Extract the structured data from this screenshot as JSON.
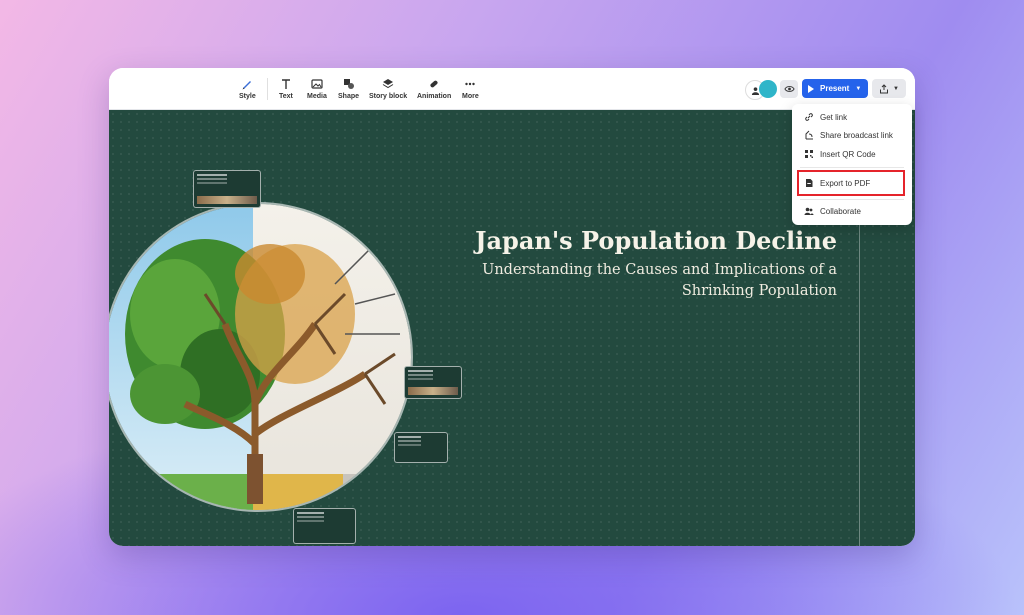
{
  "toolbar": {
    "tools": [
      {
        "label": "Style",
        "icon": "pen-icon"
      },
      {
        "label": "Text",
        "icon": "text-icon"
      },
      {
        "label": "Media",
        "icon": "image-icon"
      },
      {
        "label": "Shape",
        "icon": "shape-icon"
      },
      {
        "label": "Story block",
        "icon": "layers-icon"
      },
      {
        "label": "Animation",
        "icon": "animation-icon"
      },
      {
        "label": "More",
        "icon": "more-icon"
      }
    ],
    "present_label": "Present",
    "accent_color": "#2563eb"
  },
  "slide": {
    "title": "Japan's Population Decline",
    "subtitle": "Understanding the Causes and Implications of a Shrinking Population",
    "background_color": "#234a3f"
  },
  "share_menu": {
    "items": [
      {
        "label": "Get link",
        "icon": "link-icon"
      },
      {
        "label": "Share broadcast link",
        "icon": "broadcast-icon"
      },
      {
        "label": "Insert QR Code",
        "icon": "qr-code-icon"
      },
      {
        "label": "Export to PDF",
        "icon": "pdf-icon",
        "highlighted": true
      },
      {
        "label": "Collaborate",
        "icon": "collaborate-icon"
      }
    ],
    "highlight_color": "#e5242b"
  }
}
